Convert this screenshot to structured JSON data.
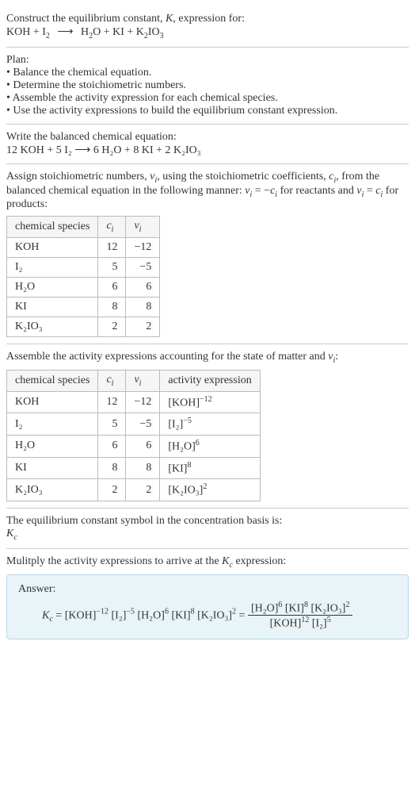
{
  "header": {
    "line1": "Construct the equilibrium constant, ",
    "K": "K",
    "line1b": ", expression for:",
    "eq_lhs": "KOH + I",
    "eq_lhs_sub": "2",
    "arrow": "⟶",
    "eq_rhs": "H",
    "eq_rhs_sub1": "2",
    "eq_rhs_b": "O + KI + K",
    "eq_rhs_sub2": "2",
    "eq_rhs_c": "IO",
    "eq_rhs_sub3": "3"
  },
  "plan": {
    "title": "Plan:",
    "b1": "• Balance the chemical equation.",
    "b2": "• Determine the stoichiometric numbers.",
    "b3": "• Assemble the activity expression for each chemical species.",
    "b4": "• Use the activity expressions to build the equilibrium constant expression."
  },
  "balanced": {
    "intro": "Write the balanced chemical equation:",
    "eq": "12 KOH + 5 I₂  ⟶  6 H₂O + 8 KI + 2 K₂IO₃"
  },
  "assign": {
    "intro1": "Assign stoichiometric numbers, ",
    "nu": "ν",
    "sub_i": "i",
    "intro2": ", using the stoichiometric coefficients, ",
    "c": "c",
    "intro3": ", from the balanced chemical equation in the following manner: ",
    "eq1": "ν",
    "eq1b": " = −",
    "eq1c": "c",
    "intro4": " for reactants and ",
    "eq2": "ν",
    "eq2b": " = ",
    "eq2c": "c",
    "intro5": " for products:",
    "table": {
      "h1": "chemical species",
      "h2": "c",
      "h3": "ν",
      "rows": [
        {
          "sp": "KOH",
          "c": "12",
          "nu": "−12"
        },
        {
          "sp": "I₂",
          "c": "5",
          "nu": "−5"
        },
        {
          "sp": "H₂O",
          "c": "6",
          "nu": "6"
        },
        {
          "sp": "KI",
          "c": "8",
          "nu": "8"
        },
        {
          "sp": "K₂IO₃",
          "c": "2",
          "nu": "2"
        }
      ]
    }
  },
  "activity": {
    "intro1": "Assemble the activity expressions accounting for the state of matter and ",
    "nu": "ν",
    "sub_i": "i",
    "intro2": ":",
    "table": {
      "h1": "chemical species",
      "h2": "c",
      "h3": "ν",
      "h4": "activity expression",
      "rows": [
        {
          "sp": "KOH",
          "c": "12",
          "nu": "−12",
          "act_base": "[KOH]",
          "act_exp": "−12"
        },
        {
          "sp": "I₂",
          "c": "5",
          "nu": "−5",
          "act_base": "[I₂]",
          "act_exp": "−5"
        },
        {
          "sp": "H₂O",
          "c": "6",
          "nu": "6",
          "act_base": "[H₂O]",
          "act_exp": "6"
        },
        {
          "sp": "KI",
          "c": "8",
          "nu": "8",
          "act_base": "[KI]",
          "act_exp": "8"
        },
        {
          "sp": "K₂IO₃",
          "c": "2",
          "nu": "2",
          "act_base": "[K₂IO₃]",
          "act_exp": "2"
        }
      ]
    }
  },
  "eq_symbol": {
    "line1": "The equilibrium constant symbol in the concentration basis is:",
    "K": "K",
    "sub": "c"
  },
  "multiply": {
    "line1": "Mulitply the activity expressions to arrive at the ",
    "K": "K",
    "sub": "c",
    "line2": " expression:"
  },
  "answer": {
    "title": "Answer:",
    "Kc_K": "K",
    "Kc_sub": "c",
    "eq": " = ",
    "t1": "[KOH]",
    "e1": "−12",
    "t2": "[I₂]",
    "e2": "−5",
    "t3": "[H₂O]",
    "e3": "6",
    "t4": "[KI]",
    "e4": "8",
    "t5": "[K₂IO₃]",
    "e5": "2",
    "eq2": " = ",
    "num1": "[H₂O]",
    "ne1": "6",
    "num2": "[KI]",
    "ne2": "8",
    "num3": "[K₂IO₃]",
    "ne3": "2",
    "den1": "[KOH]",
    "de1": "12",
    "den2": "[I₂]",
    "de2": "5"
  }
}
